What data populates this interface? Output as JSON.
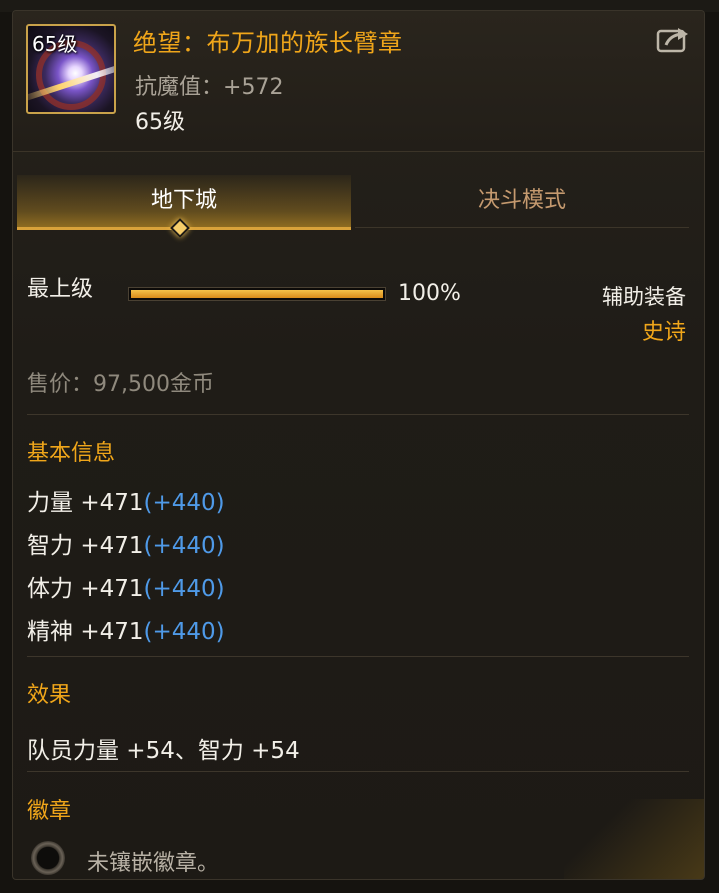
{
  "item": {
    "icon_level": "65级",
    "name": "绝望：布万加的族长臂章",
    "resist_label": "抗魔值：",
    "resist_value": "+572",
    "level": "65级"
  },
  "tabs": [
    {
      "label": "地下城",
      "active": true
    },
    {
      "label": "决斗模式",
      "active": false
    }
  ],
  "grade": {
    "label": "最上级",
    "percent_text": "100%",
    "percent_value": 1.0
  },
  "equip": {
    "type": "辅助装备",
    "rarity": "史诗"
  },
  "price": "售价：97,500金币",
  "basic_info": {
    "title": "基本信息",
    "stats": [
      {
        "label": "力量",
        "value": "+471",
        "bonus": "(+440)"
      },
      {
        "label": "智力",
        "value": "+471",
        "bonus": "(+440)"
      },
      {
        "label": "体力",
        "value": "+471",
        "bonus": "(+440)"
      },
      {
        "label": "精神",
        "value": "+471",
        "bonus": "(+440)"
      }
    ]
  },
  "effect": {
    "title": "效果",
    "text": "队员力量 +54、智力 +54"
  },
  "emblem": {
    "title": "徽章",
    "text": "未镶嵌徽章。"
  },
  "icons": {
    "share": "share-export-icon",
    "emblem_slot": "emblem-slot-icon",
    "item": "armband-item-icon"
  },
  "colors": {
    "accent": "#f0a61a",
    "bonus": "#4f9ae8",
    "text": "#f2efe8",
    "muted": "#8f897d"
  }
}
